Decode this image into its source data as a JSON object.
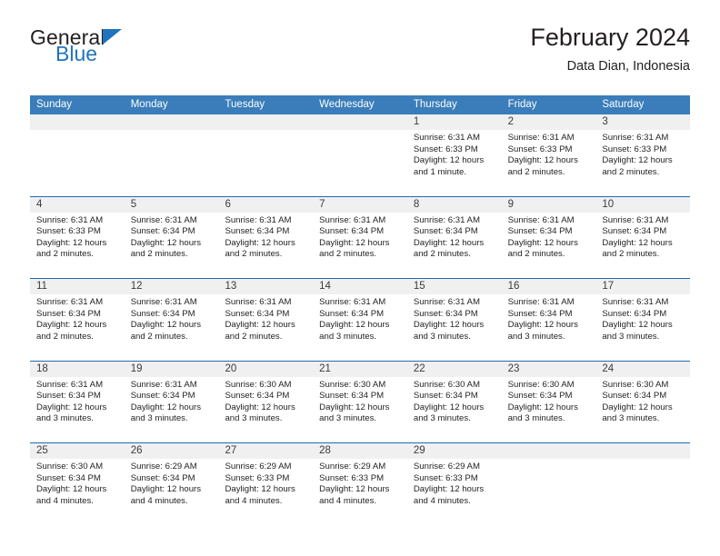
{
  "brand": {
    "line1": "General",
    "line2": "Blue",
    "accent_color": "#1f74bd"
  },
  "header": {
    "title": "February 2024",
    "subtitle": "Data Dian, Indonesia"
  },
  "calendar": {
    "header_color": "#3a7dba",
    "weekdays": [
      "Sunday",
      "Monday",
      "Tuesday",
      "Wednesday",
      "Thursday",
      "Friday",
      "Saturday"
    ],
    "weeks": [
      [
        {
          "day": "",
          "sunrise": "",
          "sunset": "",
          "daylight": "",
          "empty": true
        },
        {
          "day": "",
          "sunrise": "",
          "sunset": "",
          "daylight": "",
          "empty": true
        },
        {
          "day": "",
          "sunrise": "",
          "sunset": "",
          "daylight": "",
          "empty": true
        },
        {
          "day": "",
          "sunrise": "",
          "sunset": "",
          "daylight": "",
          "empty": true
        },
        {
          "day": "1",
          "sunrise": "Sunrise: 6:31 AM",
          "sunset": "Sunset: 6:33 PM",
          "daylight": "Daylight: 12 hours and 1 minute."
        },
        {
          "day": "2",
          "sunrise": "Sunrise: 6:31 AM",
          "sunset": "Sunset: 6:33 PM",
          "daylight": "Daylight: 12 hours and 2 minutes."
        },
        {
          "day": "3",
          "sunrise": "Sunrise: 6:31 AM",
          "sunset": "Sunset: 6:33 PM",
          "daylight": "Daylight: 12 hours and 2 minutes."
        }
      ],
      [
        {
          "day": "4",
          "sunrise": "Sunrise: 6:31 AM",
          "sunset": "Sunset: 6:33 PM",
          "daylight": "Daylight: 12 hours and 2 minutes."
        },
        {
          "day": "5",
          "sunrise": "Sunrise: 6:31 AM",
          "sunset": "Sunset: 6:34 PM",
          "daylight": "Daylight: 12 hours and 2 minutes."
        },
        {
          "day": "6",
          "sunrise": "Sunrise: 6:31 AM",
          "sunset": "Sunset: 6:34 PM",
          "daylight": "Daylight: 12 hours and 2 minutes."
        },
        {
          "day": "7",
          "sunrise": "Sunrise: 6:31 AM",
          "sunset": "Sunset: 6:34 PM",
          "daylight": "Daylight: 12 hours and 2 minutes."
        },
        {
          "day": "8",
          "sunrise": "Sunrise: 6:31 AM",
          "sunset": "Sunset: 6:34 PM",
          "daylight": "Daylight: 12 hours and 2 minutes."
        },
        {
          "day": "9",
          "sunrise": "Sunrise: 6:31 AM",
          "sunset": "Sunset: 6:34 PM",
          "daylight": "Daylight: 12 hours and 2 minutes."
        },
        {
          "day": "10",
          "sunrise": "Sunrise: 6:31 AM",
          "sunset": "Sunset: 6:34 PM",
          "daylight": "Daylight: 12 hours and 2 minutes."
        }
      ],
      [
        {
          "day": "11",
          "sunrise": "Sunrise: 6:31 AM",
          "sunset": "Sunset: 6:34 PM",
          "daylight": "Daylight: 12 hours and 2 minutes."
        },
        {
          "day": "12",
          "sunrise": "Sunrise: 6:31 AM",
          "sunset": "Sunset: 6:34 PM",
          "daylight": "Daylight: 12 hours and 2 minutes."
        },
        {
          "day": "13",
          "sunrise": "Sunrise: 6:31 AM",
          "sunset": "Sunset: 6:34 PM",
          "daylight": "Daylight: 12 hours and 2 minutes."
        },
        {
          "day": "14",
          "sunrise": "Sunrise: 6:31 AM",
          "sunset": "Sunset: 6:34 PM",
          "daylight": "Daylight: 12 hours and 3 minutes."
        },
        {
          "day": "15",
          "sunrise": "Sunrise: 6:31 AM",
          "sunset": "Sunset: 6:34 PM",
          "daylight": "Daylight: 12 hours and 3 minutes."
        },
        {
          "day": "16",
          "sunrise": "Sunrise: 6:31 AM",
          "sunset": "Sunset: 6:34 PM",
          "daylight": "Daylight: 12 hours and 3 minutes."
        },
        {
          "day": "17",
          "sunrise": "Sunrise: 6:31 AM",
          "sunset": "Sunset: 6:34 PM",
          "daylight": "Daylight: 12 hours and 3 minutes."
        }
      ],
      [
        {
          "day": "18",
          "sunrise": "Sunrise: 6:31 AM",
          "sunset": "Sunset: 6:34 PM",
          "daylight": "Daylight: 12 hours and 3 minutes."
        },
        {
          "day": "19",
          "sunrise": "Sunrise: 6:31 AM",
          "sunset": "Sunset: 6:34 PM",
          "daylight": "Daylight: 12 hours and 3 minutes."
        },
        {
          "day": "20",
          "sunrise": "Sunrise: 6:30 AM",
          "sunset": "Sunset: 6:34 PM",
          "daylight": "Daylight: 12 hours and 3 minutes."
        },
        {
          "day": "21",
          "sunrise": "Sunrise: 6:30 AM",
          "sunset": "Sunset: 6:34 PM",
          "daylight": "Daylight: 12 hours and 3 minutes."
        },
        {
          "day": "22",
          "sunrise": "Sunrise: 6:30 AM",
          "sunset": "Sunset: 6:34 PM",
          "daylight": "Daylight: 12 hours and 3 minutes."
        },
        {
          "day": "23",
          "sunrise": "Sunrise: 6:30 AM",
          "sunset": "Sunset: 6:34 PM",
          "daylight": "Daylight: 12 hours and 3 minutes."
        },
        {
          "day": "24",
          "sunrise": "Sunrise: 6:30 AM",
          "sunset": "Sunset: 6:34 PM",
          "daylight": "Daylight: 12 hours and 3 minutes."
        }
      ],
      [
        {
          "day": "25",
          "sunrise": "Sunrise: 6:30 AM",
          "sunset": "Sunset: 6:34 PM",
          "daylight": "Daylight: 12 hours and 4 minutes."
        },
        {
          "day": "26",
          "sunrise": "Sunrise: 6:29 AM",
          "sunset": "Sunset: 6:34 PM",
          "daylight": "Daylight: 12 hours and 4 minutes."
        },
        {
          "day": "27",
          "sunrise": "Sunrise: 6:29 AM",
          "sunset": "Sunset: 6:33 PM",
          "daylight": "Daylight: 12 hours and 4 minutes."
        },
        {
          "day": "28",
          "sunrise": "Sunrise: 6:29 AM",
          "sunset": "Sunset: 6:33 PM",
          "daylight": "Daylight: 12 hours and 4 minutes."
        },
        {
          "day": "29",
          "sunrise": "Sunrise: 6:29 AM",
          "sunset": "Sunset: 6:33 PM",
          "daylight": "Daylight: 12 hours and 4 minutes."
        },
        {
          "day": "",
          "sunrise": "",
          "sunset": "",
          "daylight": "",
          "empty": true
        },
        {
          "day": "",
          "sunrise": "",
          "sunset": "",
          "daylight": "",
          "empty": true
        }
      ]
    ]
  }
}
